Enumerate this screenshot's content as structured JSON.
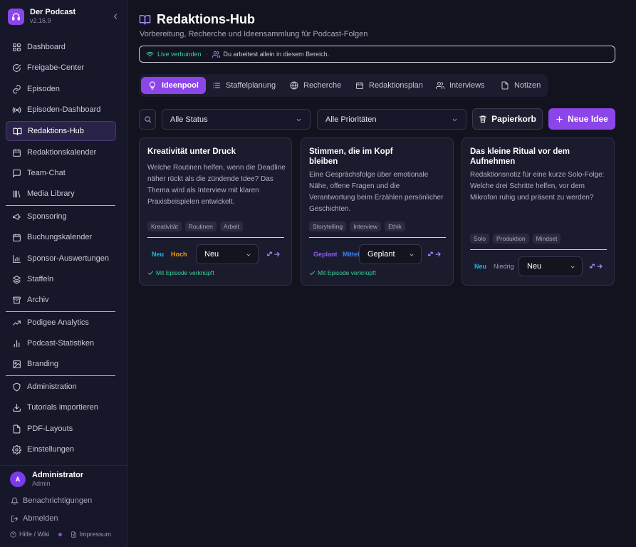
{
  "app": {
    "name": "Der Podcast",
    "version": "v2.16.9"
  },
  "sidebar": {
    "items": [
      {
        "label": "Dashboard",
        "icon": "grid-icon"
      },
      {
        "label": "Freigabe-Center",
        "icon": "check-circle-icon"
      },
      {
        "label": "Episoden",
        "icon": "link-icon"
      },
      {
        "label": "Episoden-Dashboard",
        "icon": "broadcast-icon"
      },
      {
        "label": "Redaktions-Hub",
        "icon": "book-open-icon",
        "active": true
      },
      {
        "label": "Redaktionskalender",
        "icon": "calendar-icon"
      },
      {
        "label": "Team-Chat",
        "icon": "message-icon"
      },
      {
        "label": "Media Library",
        "icon": "library-icon"
      },
      {
        "label": "Sponsoring",
        "icon": "megaphone-icon"
      },
      {
        "label": "Buchungskalender",
        "icon": "calendar-icon"
      },
      {
        "label": "Sponsor-Auswertungen",
        "icon": "bar-chart-icon"
      },
      {
        "label": "Staffeln",
        "icon": "layers-icon"
      },
      {
        "label": "Archiv",
        "icon": "archive-icon"
      },
      {
        "label": "Podigee Analytics",
        "icon": "trending-up-icon"
      },
      {
        "label": "Podcast-Statistiken",
        "icon": "bar-chart-icon"
      },
      {
        "label": "Branding",
        "icon": "image-icon"
      },
      {
        "label": "Administration",
        "icon": "shield-icon"
      },
      {
        "label": "Tutorials importieren",
        "icon": "download-icon"
      },
      {
        "label": "PDF-Layouts",
        "icon": "file-icon"
      },
      {
        "label": "Einstellungen",
        "icon": "gear-icon"
      }
    ],
    "user": {
      "initial": "A",
      "name": "Administrator",
      "role": "Admin"
    },
    "notifications": "Benachrichtigungen",
    "logout": "Abmelden",
    "help": "Hilfe / Wiki",
    "imprint": "Impressum"
  },
  "header": {
    "title": "Redaktions-Hub",
    "subtitle": "Vorbereitung, Recherche und Ideensammlung für Podcast-Folgen",
    "live": "Live verbunden",
    "presence": "Du arbeitest allein in diesem Bereich."
  },
  "tabs": [
    "Ideenpool",
    "Staffelplanung",
    "Recherche",
    "Redaktionsplan",
    "Interviews",
    "Notizen"
  ],
  "filters": {
    "status": "Alle Status",
    "priority": "Alle Prioritäten",
    "trash": "Papierkorb",
    "new": "Neue Idee"
  },
  "cards": [
    {
      "title": "Kreativität unter Druck",
      "description": "Welche Routinen helfen, wenn die Deadline näher rückt als die zündende Idee? Das Thema wird als Interview mit klaren Praxisbeispielen entwickelt.",
      "tags": [
        "Kreativität",
        "Routinen",
        "Arbeit"
      ],
      "status_badge": "Neu",
      "priority_badge": "Hoch",
      "status_color": "#22b8d8",
      "priority_color": "#f59e0b",
      "select_value": "Neu",
      "linked": "Mit Episode verknüpft"
    },
    {
      "title": "Stimmen, die im Kopf bleiben",
      "description": "Eine Gesprächsfolge über emotionale Nähe, offene Fragen und die Verantwortung beim Erzählen persönlicher Geschichten.",
      "tags": [
        "Storytelling",
        "Interview",
        "Ethik"
      ],
      "status_badge": "Geplant",
      "priority_badge": "Mittel",
      "status_color": "#8b5cf6",
      "priority_color": "#3b82f6",
      "select_value": "Geplant",
      "linked": "Mit Episode verknüpft"
    },
    {
      "title": "Das kleine Ritual vor dem Aufnehmen",
      "description": "Redaktionsnotiz für eine kurze Solo-Folge: Welche drei Schritte helfen, vor dem Mikrofon ruhig und präsent zu werden?",
      "tags": [
        "Solo",
        "Produktion",
        "Mindset"
      ],
      "status_badge": "Neu",
      "priority_badge": "Niedrig",
      "status_color": "#22b8d8",
      "priority_color": "#9a9ab0",
      "select_value": "Neu"
    }
  ],
  "colors": {
    "accent": "#8b45e8",
    "live": "#34d399",
    "background": "#13131f"
  }
}
